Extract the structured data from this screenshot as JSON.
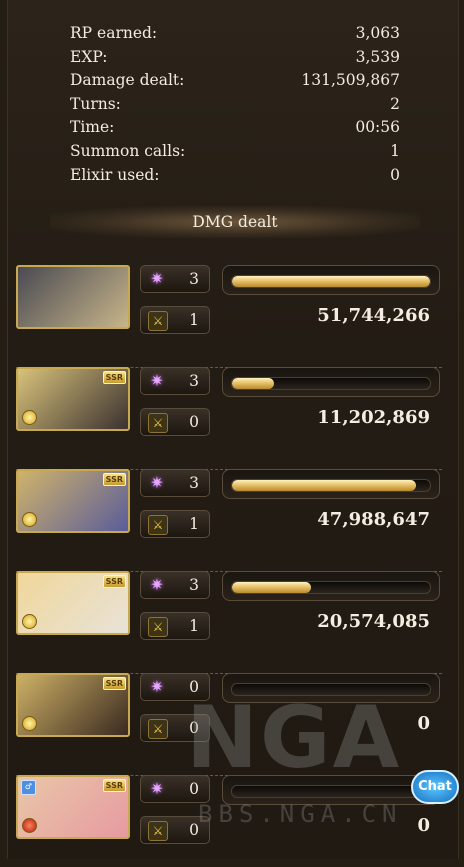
{
  "stats": [
    {
      "label": "RP earned:",
      "value": "3,063"
    },
    {
      "label": "EXP:",
      "value": "3,539"
    },
    {
      "label": "Damage dealt:",
      "value": "131,509,867"
    },
    {
      "label": "Turns:",
      "value": "2"
    },
    {
      "label": "Time:",
      "value": "00:56"
    },
    {
      "label": "Summon calls:",
      "value": "1"
    },
    {
      "label": "Elixir used:",
      "value": "0"
    }
  ],
  "section_title": "DMG dealt",
  "characters": [
    {
      "skills": "3",
      "charge_attacks": "1",
      "damage": "51,744,266",
      "bar_fraction": 1.0,
      "ssr": "",
      "portrait_colors": [
        "#4a4a52",
        "#c7b58a"
      ]
    },
    {
      "skills": "3",
      "charge_attacks": "0",
      "damage": "11,202,869",
      "bar_fraction": 0.21,
      "ssr": "SSR",
      "portrait_colors": [
        "#d8c27a",
        "#3b3230"
      ]
    },
    {
      "skills": "3",
      "charge_attacks": "1",
      "damage": "47,988,647",
      "bar_fraction": 0.93,
      "ssr": "SSR",
      "portrait_colors": [
        "#cfb36a",
        "#5a5c9a"
      ]
    },
    {
      "skills": "3",
      "charge_attacks": "1",
      "damage": "20,574,085",
      "bar_fraction": 0.4,
      "ssr": "SSR",
      "portrait_colors": [
        "#f0d79a",
        "#e8e2d8"
      ]
    },
    {
      "skills": "0",
      "charge_attacks": "0",
      "damage": "0",
      "bar_fraction": 0.0,
      "ssr": "SSR",
      "portrait_colors": [
        "#cdb066",
        "#3a2a20"
      ]
    },
    {
      "skills": "0",
      "charge_attacks": "0",
      "damage": "0",
      "bar_fraction": 0.0,
      "ssr": "SSR",
      "portrait_colors": [
        "#e8c7a8",
        "#e79aa0"
      ]
    }
  ],
  "icons": {
    "skill": "sparkle-icon",
    "charge_attack": "crossed-swords-icon",
    "medal": "medal-icon",
    "element": "element-icon"
  },
  "watermark": {
    "logo": "NGA",
    "url": "BBS.NGA.CN"
  },
  "chat_label": "Chat"
}
